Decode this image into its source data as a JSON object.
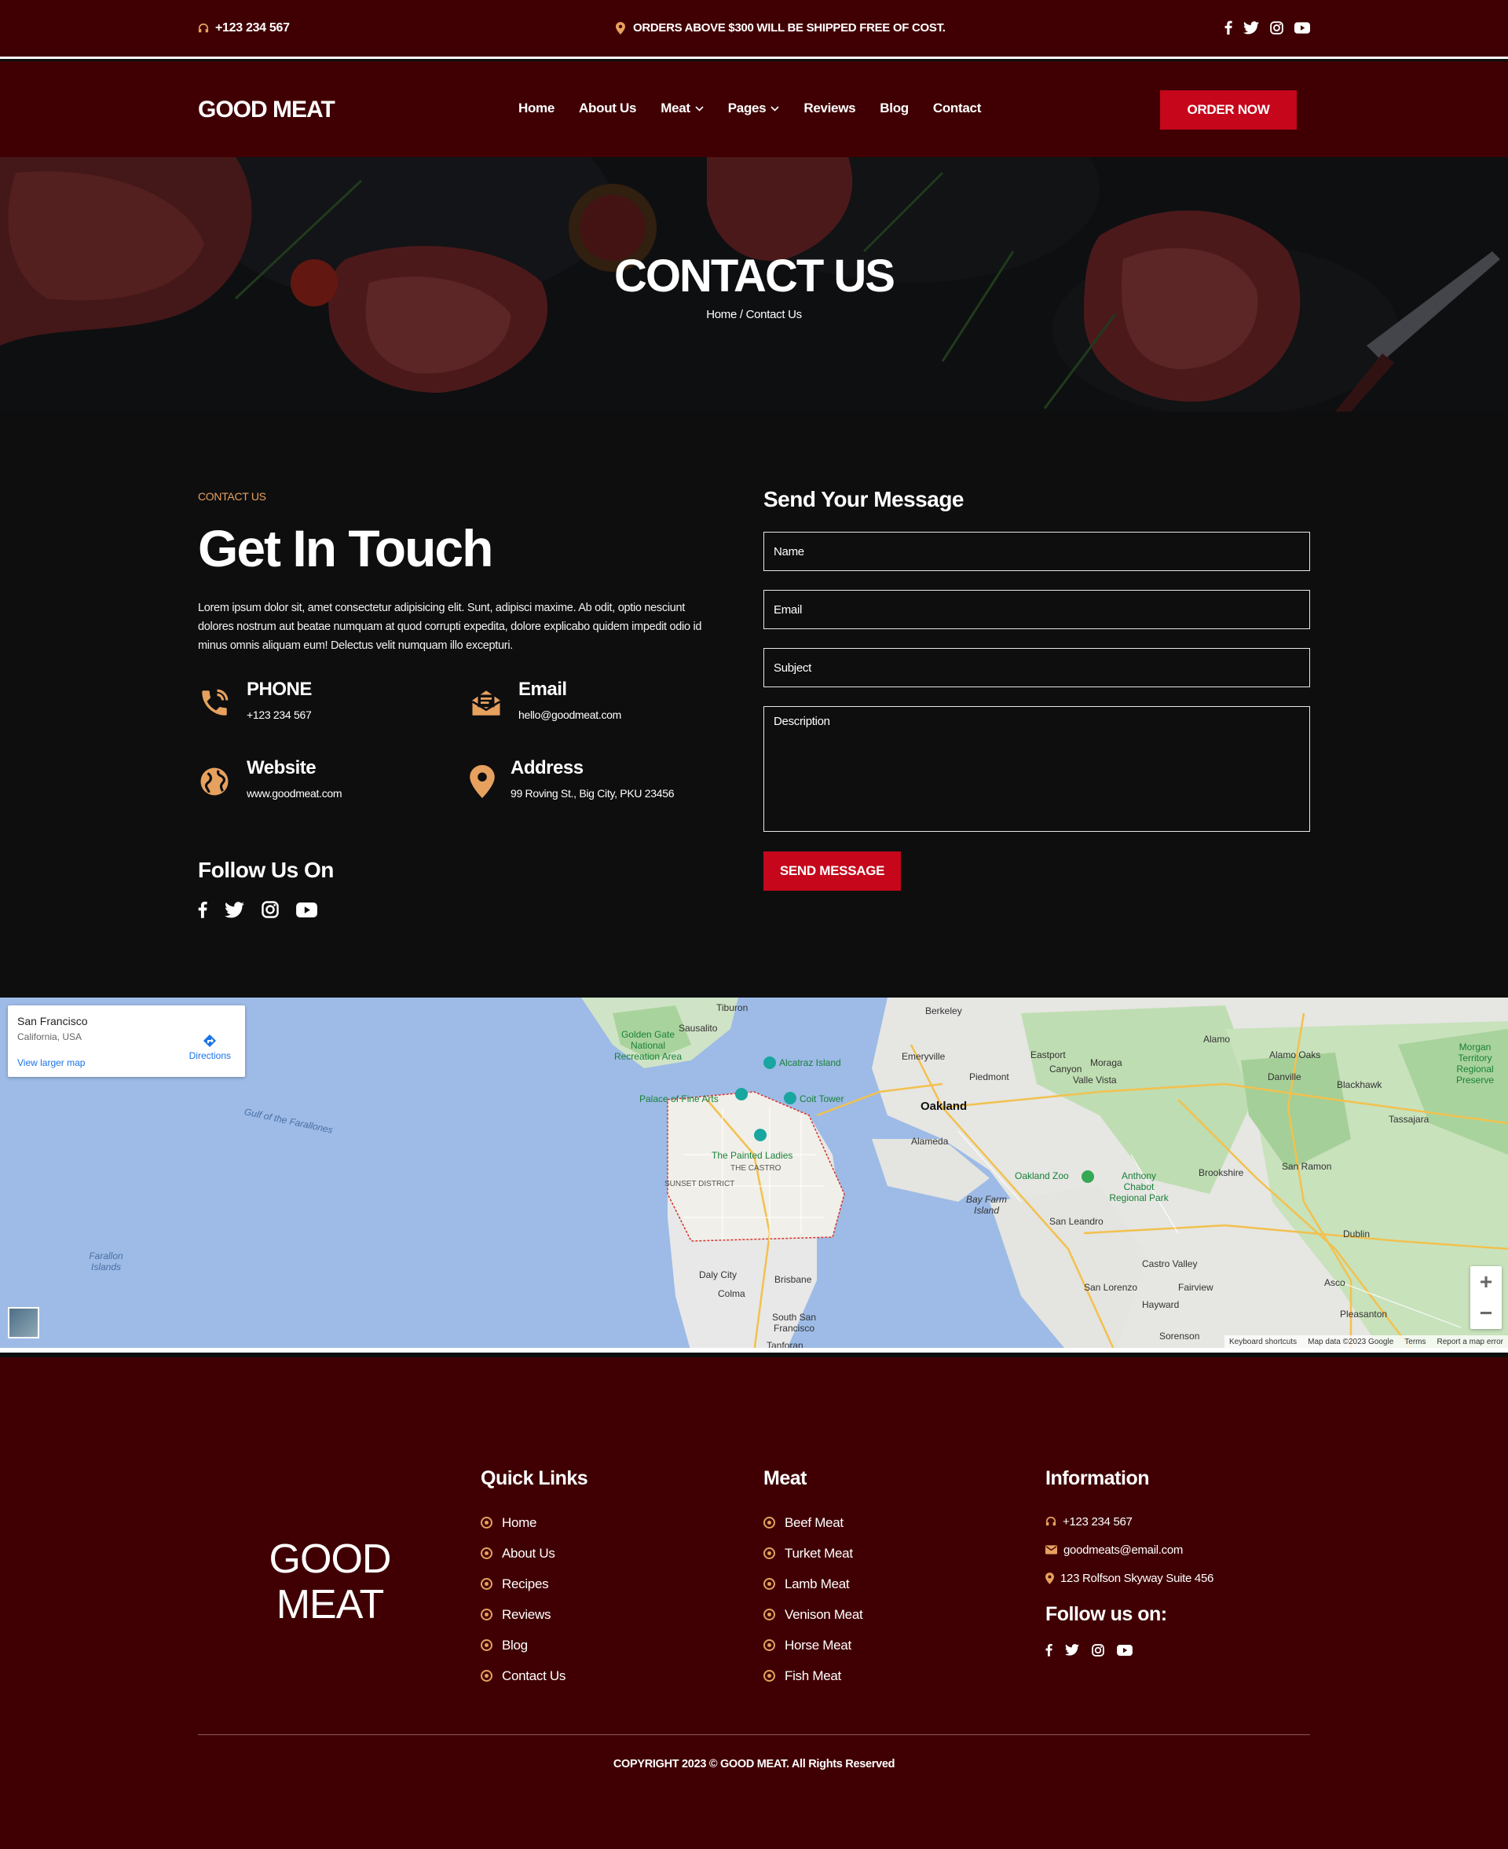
{
  "topbar": {
    "phone": "+123 234 567",
    "promo": "ORDERS ABOVE $300 WILL BE SHIPPED FREE OF COST.",
    "social": [
      "facebook-icon",
      "twitter-icon",
      "instagram-icon",
      "youtube-icon"
    ]
  },
  "header": {
    "logo": "GOOD MEAT",
    "nav": [
      {
        "label": "Home"
      },
      {
        "label": "About Us"
      },
      {
        "label": "Meat",
        "dropdown": true
      },
      {
        "label": "Pages",
        "dropdown": true
      },
      {
        "label": "Reviews"
      },
      {
        "label": "Blog"
      },
      {
        "label": "Contact"
      }
    ],
    "cta": "ORDER NOW"
  },
  "hero": {
    "title": "CONTACT US",
    "breadcrumb": "Home / Contact Us"
  },
  "contact": {
    "eyebrow": "CONTACT US",
    "title": "Get In Touch",
    "text": "Lorem ipsum dolor sit, amet consectetur adipisicing elit. Sunt, adipisci maxime. Ab odit, optio nesciunt dolores nostrum aut beatae numquam at quod corrupti expedita, dolore explicabo quidem impedit odio id minus omnis aliquam eum! Delectus velit numquam illo excepturi.",
    "phone": {
      "title": "PHONE",
      "value": "+123 234 567"
    },
    "email": {
      "title": "Email",
      "value": "hello@goodmeat.com"
    },
    "website": {
      "title": "Website",
      "value": "www.goodmeat.com"
    },
    "address": {
      "title": "Address",
      "value": "99 Roving St., Big City, PKU 23456"
    },
    "follow_title": "Follow Us On"
  },
  "form": {
    "title": "Send Your Message",
    "name_placeholder": "Name",
    "email_placeholder": "Email",
    "subject_placeholder": "Subject",
    "description_placeholder": "Description",
    "submit": "SEND MESSAGE"
  },
  "map": {
    "place": "San Francisco",
    "region": "California, USA",
    "directions": "Directions",
    "larger": "View larger map",
    "labels": {
      "oakland": "Oakland",
      "alameda": "Alameda",
      "berkeley": "Berkeley",
      "sausalito": "Sausalito",
      "tiburon": "Tiburon",
      "emeryville": "Emeryville",
      "piedmont": "Piedmont",
      "eastport": "Eastport",
      "moraga": "Moraga",
      "canyon": "Canyon",
      "valle_vista": "Valle Vista",
      "alamo": "Alamo",
      "alamo_oaks": "Alamo Oaks",
      "danville": "Danville",
      "blackhawk": "Blackhawk",
      "tassajara": "Tassajara",
      "brookshire": "Brookshire",
      "san_ramon": "San Ramon",
      "dublin": "Dublin",
      "castro_valley": "Castro Valley",
      "fairview": "Fairview",
      "asco": "Asco",
      "pleasanton": "Pleasanton",
      "hayward": "Hayward",
      "san_lorenzo": "San Lorenzo",
      "san_leandro": "San Leandro",
      "sorenson": "Sorenson",
      "bay_farm": "Bay Farm Island",
      "daly_city": "Daly City",
      "colma": "Colma",
      "brisbane": "Brisbane",
      "south_sf": "South San Francisco",
      "tanforan": "Tanforan",
      "alcatraz": "Alcatraz Island",
      "coit_tower": "Coit Tower",
      "palace": "Palace of Fine Arts",
      "painted_ladies": "The Painted Ladies",
      "oakland_zoo": "Oakland Zoo",
      "anthony_chabot": "Anthony Chabot Regional Park",
      "golden_gate": "Golden Gate National Recreation Area",
      "morgan_territory": "Morgan Territory Regional Preserve",
      "gulf": "Gulf of the Farallones",
      "farallon": "Farallon Islands",
      "castro": "THE CASTRO",
      "sunset": "SUNSET DISTRICT"
    },
    "footer": [
      "Keyboard shortcuts",
      "Map data ©2023 Google",
      "Terms",
      "Report a map error"
    ]
  },
  "footer": {
    "logo_line1": "GOOD",
    "logo_line2": "MEAT",
    "quick_title": "Quick Links",
    "quick_links": [
      "Home",
      "About Us",
      "Recipes",
      "Reviews",
      "Blog",
      "Contact Us"
    ],
    "meat_title": "Meat",
    "meat_links": [
      "Beef Meat",
      "Turket Meat",
      "Lamb Meat",
      "Venison Meat",
      "Horse Meat",
      "Fish Meat"
    ],
    "info_title": "Information",
    "info_phone": "+123 234 567",
    "info_email": "goodmeats@email.com",
    "info_address": "123 Rolfson Skyway Suite 456",
    "follow_title": "Follow us on:",
    "copyright": "COPYRIGHT 2023 © GOOD MEAT. All Rights Reserved"
  },
  "colors": {
    "maroon": "#400003",
    "accent_red": "#c5061b",
    "accent_gold": "#e6a15e",
    "dark_bg": "#0e0e0f"
  }
}
